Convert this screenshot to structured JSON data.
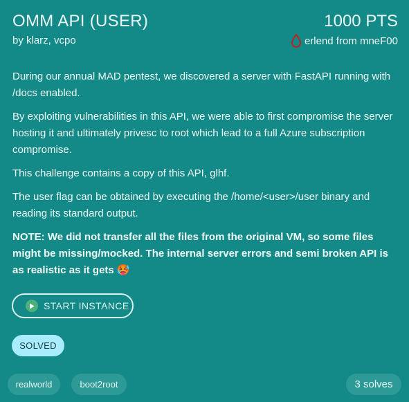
{
  "challenge": {
    "title": "OMM API (USER)",
    "points": "1000 PTS",
    "authors": "by klarz, vcpo",
    "first_blood": "erlend from mneF00",
    "first_blood_icon": "blood-drop-icon"
  },
  "description": {
    "paragraphs": [
      "During our annual MAD pentest, we discovered a server with FastAPI running with /docs enabled.",
      "By exploiting vulnerabilities in this API, we were able to first compromise the server hosting it and ultimately privesc to root which lead to a full Azure subscription compromise.",
      "This challenge contains a copy of this API, glhf.",
      "The user flag can be obtained by executing the /home/<user>/user binary and reading its standard output."
    ],
    "note": "NOTE: We did not transfer all the files from the original VM, so some files might be missing/mocked. The internal server errors and semi broken API is as realistic as it gets 🥵"
  },
  "actions": {
    "start_label": "START INSTANCE",
    "start_icon": "play-icon"
  },
  "status": {
    "solved_label": "SOLVED"
  },
  "tags": [
    "realworld",
    "boot2root"
  ],
  "solves": "3 solves",
  "colors": {
    "background": "#148a88",
    "badge": "#a9ecfb",
    "tag": "#2e9a97",
    "play": "#4cb07a",
    "blood": "#c0211f"
  }
}
